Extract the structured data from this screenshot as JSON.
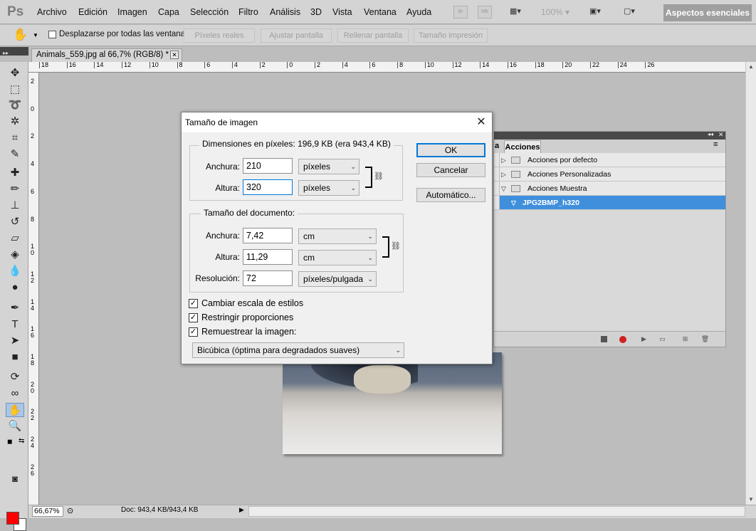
{
  "app": {
    "logo": "Ps"
  },
  "menu": [
    "Archivo",
    "Edición",
    "Imagen",
    "Capa",
    "Selección",
    "Filtro",
    "Análisis",
    "3D",
    "Vista",
    "Ventana",
    "Ayuda"
  ],
  "menubar": {
    "br_icon": "Br",
    "mb_icon": "Mb",
    "zoom": "100%",
    "workspace": "Aspectos esenciales"
  },
  "options": {
    "scroll_all_label": "Desplazarse por todas las ventanas",
    "buttons": [
      "Píxeles reales",
      "Ajustar pantalla",
      "Rellenar pantalla",
      "Tamaño impresión"
    ]
  },
  "document": {
    "tab_title": "Animals_559.jpg al 66,7% (RGB/8) *"
  },
  "rulers": {
    "top": [
      "18",
      "16",
      "14",
      "12",
      "10",
      "8",
      "6",
      "4",
      "2",
      "0",
      "2",
      "4",
      "6",
      "8",
      "10",
      "12",
      "14",
      "16",
      "18",
      "20",
      "22",
      "24",
      "26"
    ],
    "left": [
      "2",
      "0",
      "2",
      "4",
      "6",
      "8",
      "1\n0",
      "1\n2",
      "1\n4",
      "1\n6",
      "1\n8",
      "2\n0",
      "2\n2",
      "2\n4",
      "2\n6"
    ]
  },
  "status": {
    "zoom": "66,67%",
    "doc_info": "Doc: 943,4 KB/943,4 KB"
  },
  "actions_panel": {
    "tab_cut": "a",
    "tab": "Acciones",
    "rows": [
      "Acciones por defecto",
      "Acciones Personalizadas",
      "Acciones Muestra",
      "JPG2BMP_h320"
    ]
  },
  "dialog": {
    "title": "Tamaño de imagen",
    "pixel_dims_title": "Dimensiones en píxeles: 196,9 KB (era 943,4 KB)",
    "width_label": "Anchura:",
    "height_label": "Altura:",
    "px_width": "210",
    "px_height": "320",
    "px_width_unit": "píxeles",
    "px_height_unit": "píxeles",
    "doc_size_title": "Tamaño del documento:",
    "doc_width": "7,42",
    "doc_height": "11,29",
    "doc_width_unit": "cm",
    "doc_height_unit": "cm",
    "resolution_label": "Resolución:",
    "resolution": "72",
    "resolution_unit": "píxeles/pulgada",
    "ok": "OK",
    "cancel": "Cancelar",
    "auto": "Automático...",
    "chk_scale_styles": "Cambiar escala de estilos",
    "chk_constrain": "Restringir proporciones",
    "chk_resample": "Remuestrear la imagen:",
    "resample_method": "Bicúbica (óptima para degradados suaves)"
  },
  "colors": {
    "foreground": "#ff0000",
    "background": "#ffffff",
    "selection": "#3f8fdc"
  }
}
